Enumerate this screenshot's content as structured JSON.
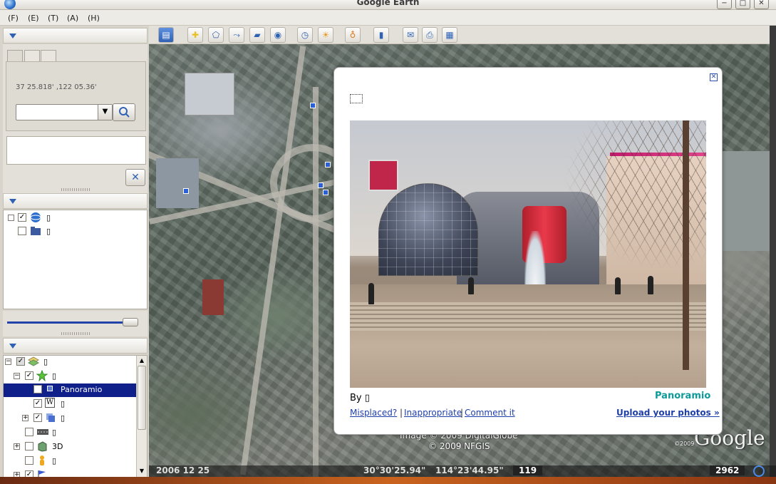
{
  "window": {
    "title": "Google Earth",
    "minimize_glyph": "−",
    "maximize_glyph": "□",
    "close_glyph": "✕"
  },
  "menu": {
    "items": [
      "(F)",
      "(E)",
      "(T)",
      "(A)",
      "(H)"
    ]
  },
  "search_panel": {
    "coords": "37 25.818' ,122 05.36'",
    "input_value": "",
    "clear_glyph": "✕"
  },
  "places": {
    "items": [
      {
        "icon": "globe-icon",
        "checked": true
      },
      {
        "icon": "folder-icon",
        "checked": false
      }
    ]
  },
  "layers": {
    "items": [
      {
        "label": "",
        "checked": true,
        "icon": "layers-icon"
      },
      {
        "label": "",
        "checked": true,
        "icon": "star-icon"
      },
      {
        "label": "Panoramio",
        "checked": true,
        "icon": "square-icon",
        "selected": true
      },
      {
        "label": "",
        "checked": true,
        "icon": "wikipedia-icon",
        "icon_glyph": "W"
      },
      {
        "label": "",
        "checked": true,
        "icon": "cards-icon"
      },
      {
        "label": "",
        "checked": false,
        "icon": "road-icon"
      },
      {
        "label": "3D",
        "checked": false,
        "icon": "building-icon"
      },
      {
        "label": "",
        "checked": false,
        "icon": "person-icon"
      },
      {
        "label": "",
        "checked": true,
        "icon": "flag-icon"
      }
    ]
  },
  "toolbar": {
    "buttons": [
      "sidebar-icon",
      "placemark-icon",
      "polygon-icon",
      "path-icon",
      "overlay-icon",
      "tour-icon",
      "clock-icon",
      "sunlight-icon",
      "planet-icon",
      "ruler-icon",
      "email-icon",
      "print-icon",
      "map-icon"
    ]
  },
  "popup": {
    "close_glyph": "✕",
    "by_label": "By",
    "logo": "Panoramio",
    "links": {
      "misplaced": "Misplaced?",
      "inappropriate": "Inappropriate",
      "comment": "Comment it"
    },
    "separator": "|",
    "upload": "Upload your photos »"
  },
  "map": {
    "copyright_line1": "Image © 2009 DigitalGlobe",
    "copyright_line2": "© 2009 NFGIS",
    "logo": "Google",
    "logo_year": "©2009"
  },
  "status": {
    "date": "2006 12 25",
    "lat": "30°30'25.94\"",
    "lon": "114°23'44.95\"",
    "elevation": "119",
    "eye_alt": "2962"
  }
}
